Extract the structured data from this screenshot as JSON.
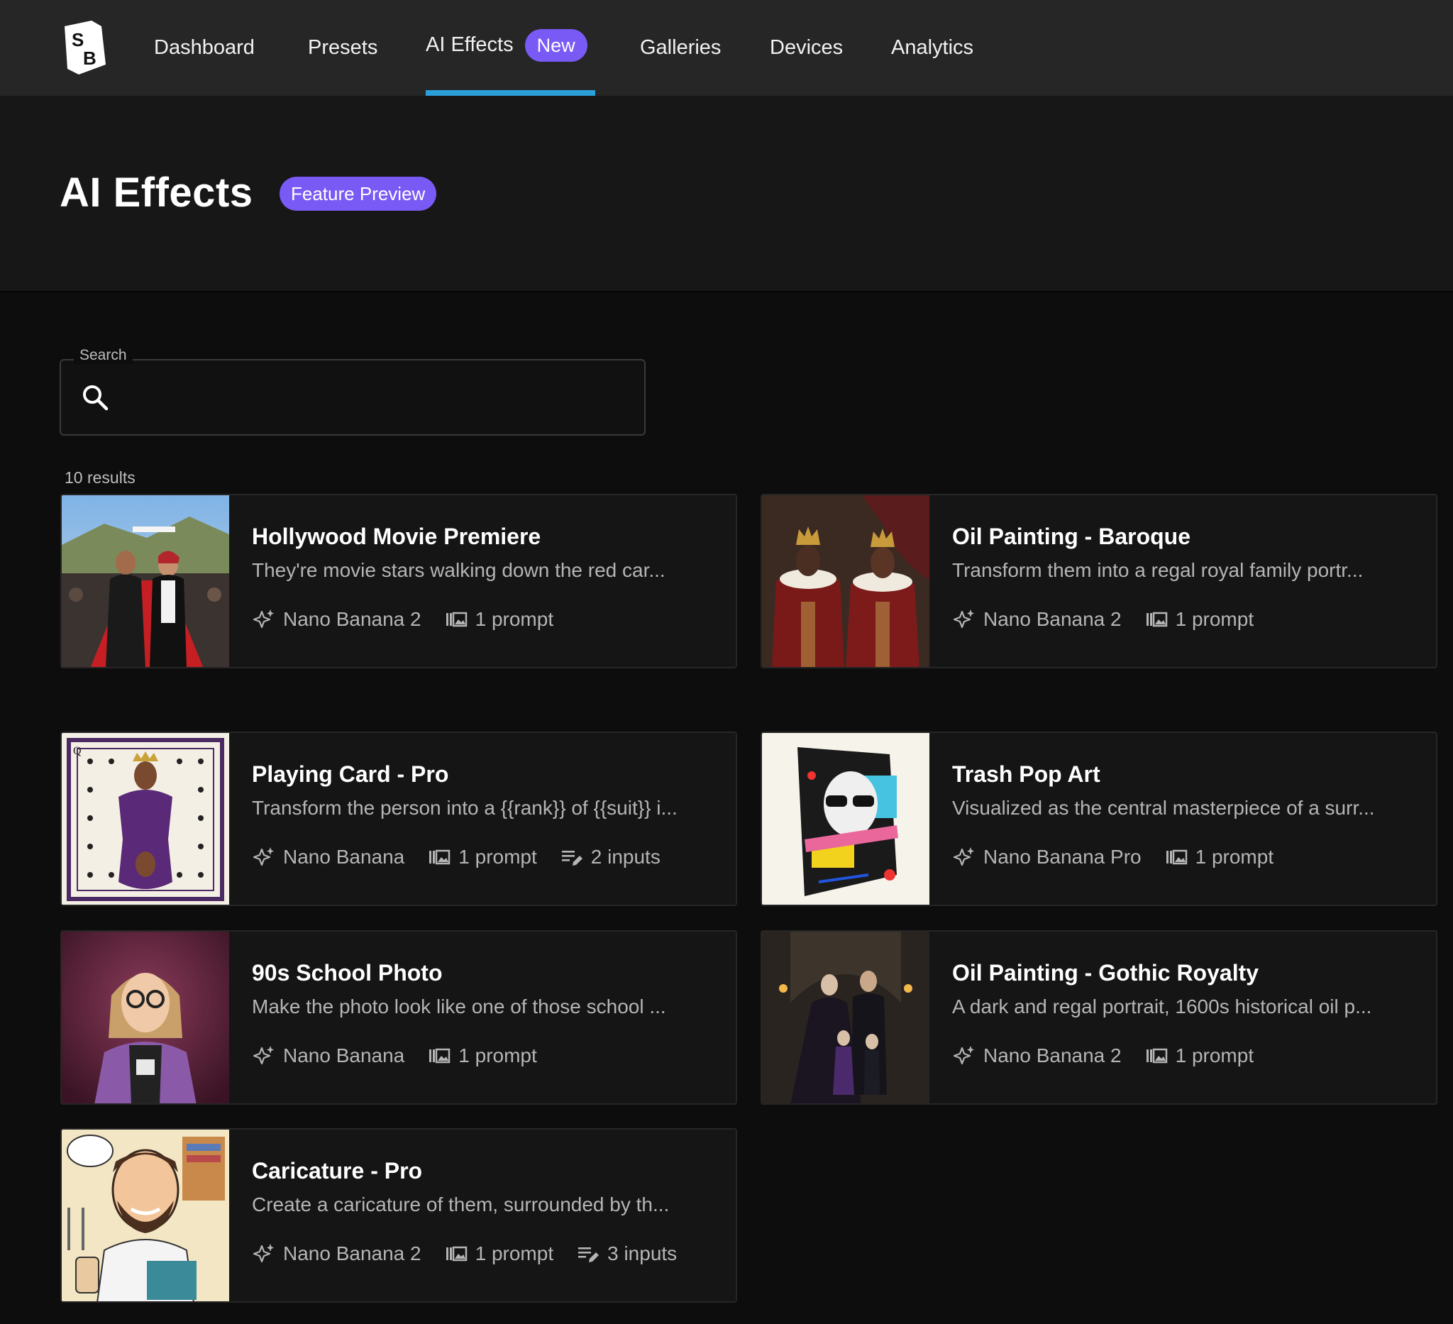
{
  "nav": {
    "logo_letters": "SB",
    "items": [
      {
        "label": "Dashboard"
      },
      {
        "label": "Presets"
      },
      {
        "label": "AI Effects",
        "badge": "New",
        "active": true
      },
      {
        "label": "Galleries"
      },
      {
        "label": "Devices"
      },
      {
        "label": "Analytics"
      }
    ],
    "active_color": "#2b9fd8",
    "badge_color": "#7a5af5"
  },
  "header": {
    "title": "AI Effects",
    "badge": "Feature Preview"
  },
  "search": {
    "label": "Search",
    "value": "",
    "icon": "search-icon"
  },
  "results": {
    "count_text": "10 results"
  },
  "cards": [
    {
      "title": "Hollywood Movie Premiere",
      "description": "They're movie stars walking down the red car...",
      "model": "Nano Banana 2",
      "prompts": "1 prompt",
      "inputs": ""
    },
    {
      "title": "Oil Painting - Baroque",
      "description": "Transform them into a regal royal family portr...",
      "model": "Nano Banana 2",
      "prompts": "1 prompt",
      "inputs": ""
    },
    {
      "title": "Playing Card - Pro",
      "description": "Transform the person into a {{rank}} of {{suit}} i...",
      "model": "Nano Banana",
      "prompts": "1 prompt",
      "inputs": "2 inputs"
    },
    {
      "title": "Trash Pop Art",
      "description": "Visualized as the central masterpiece of a surr...",
      "model": "Nano Banana Pro",
      "prompts": "1 prompt",
      "inputs": ""
    },
    {
      "title": "90s School Photo",
      "description": "Make the photo look like one of those school ...",
      "model": "Nano Banana",
      "prompts": "1 prompt",
      "inputs": ""
    },
    {
      "title": "Oil Painting - Gothic Royalty",
      "description": "A dark and regal portrait, 1600s historical oil p...",
      "model": "Nano Banana 2",
      "prompts": "1 prompt",
      "inputs": ""
    },
    {
      "title": "Caricature - Pro",
      "description": "Create a caricature of them, surrounded by th...",
      "model": "Nano Banana 2",
      "prompts": "1 prompt",
      "inputs": "3 inputs"
    }
  ]
}
